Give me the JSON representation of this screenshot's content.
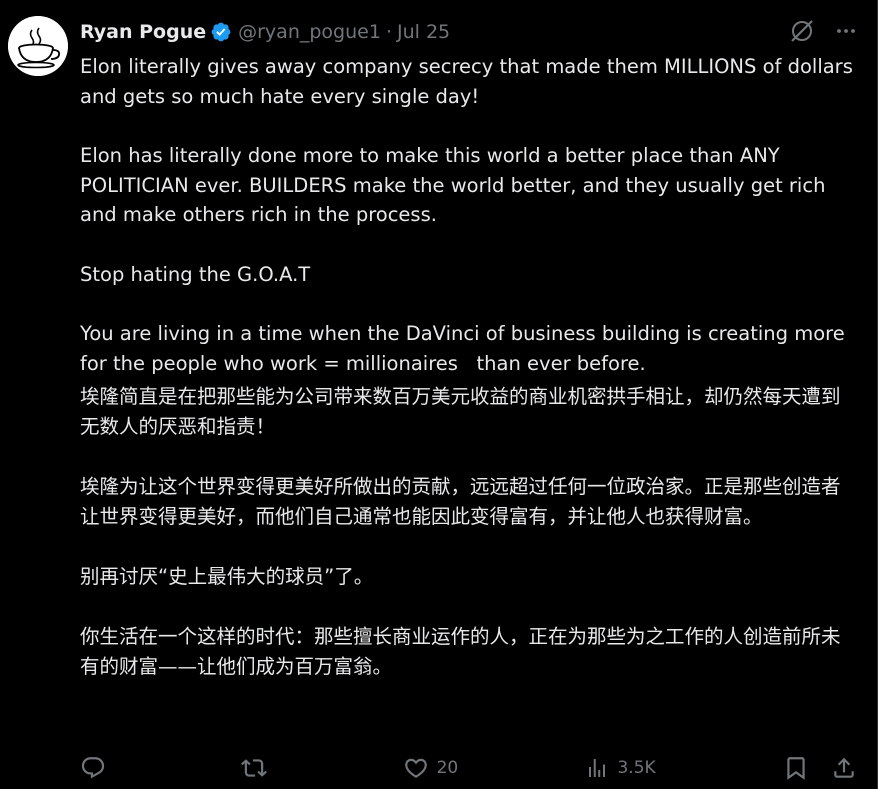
{
  "author": {
    "name": "Ryan Pogue",
    "handle": "@ryan_pogue1",
    "separator": "·",
    "date": "Jul 25"
  },
  "english": [
    "Elon literally gives away company secrecy that made them MILLIONS of dollars and gets so much hate every single day!",
    "Elon has literally done more to make this world a better place than ANY POLITICIAN ever. BUILDERS make the world better, and they usually get rich and make others rich in the process.",
    "Stop hating the G.O.A.T",
    "You are living in a time when the DaVinci of business building is creating more for the people who work = millionaires   than ever before."
  ],
  "chinese": [
    "埃隆简直是在把那些能为公司带来数百万美元收益的商业机密拱手相让，却仍然每天遭到无数人的厌恶和指责！",
    "埃隆为让这个世界变得更美好所做出的贡献，远远超过任何一位政治家。正是那些创造者让世界变得更美好，而他们自己通常也能因此变得富有，并让他人也获得财富。",
    "别再讨厌“史上最伟大的球员”了。",
    "你生活在一个这样的时代：那些擅长商业运作的人，正在为那些为之工作的人创造前所未有的财富——让他们成为百万富翁。"
  ],
  "actions": {
    "reply_count": "",
    "retweet_count": "",
    "like_count": "20",
    "views_count": "3.5K"
  },
  "colors": {
    "background": "#000000",
    "text": "#e7e9ea",
    "muted": "#71767b",
    "verified": "#1d9bf0"
  }
}
